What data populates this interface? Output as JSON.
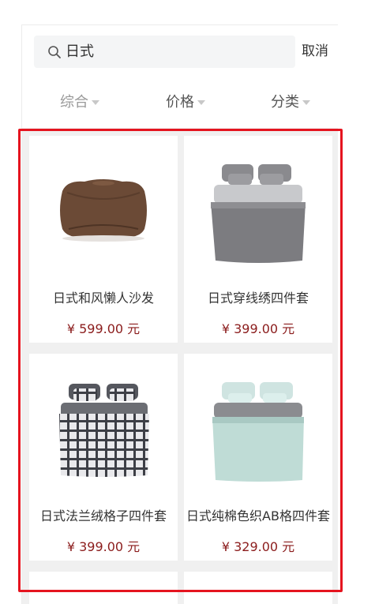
{
  "search": {
    "value": "日式",
    "cancel_label": "取消"
  },
  "tabs": [
    {
      "label": "综合"
    },
    {
      "label": "价格"
    },
    {
      "label": "分类"
    }
  ],
  "products": [
    {
      "name": "日式和风懒人沙发",
      "price": "¥ 599.00 元",
      "image": "beanbag-sofa"
    },
    {
      "name": "日式穿线绣四件套",
      "price": "¥ 399.00 元",
      "image": "grey-bedding"
    },
    {
      "name": "日式法兰绒格子四件套",
      "price": "¥ 399.00 元",
      "image": "plaid-bedding"
    },
    {
      "name": "日式纯棉色织AB格四件套",
      "price": "¥ 329.00 元",
      "image": "mint-bedding"
    }
  ],
  "colors": {
    "price": "#8b1c1c",
    "highlight": "#e5141f",
    "grid_bg": "#f0f0f0"
  }
}
